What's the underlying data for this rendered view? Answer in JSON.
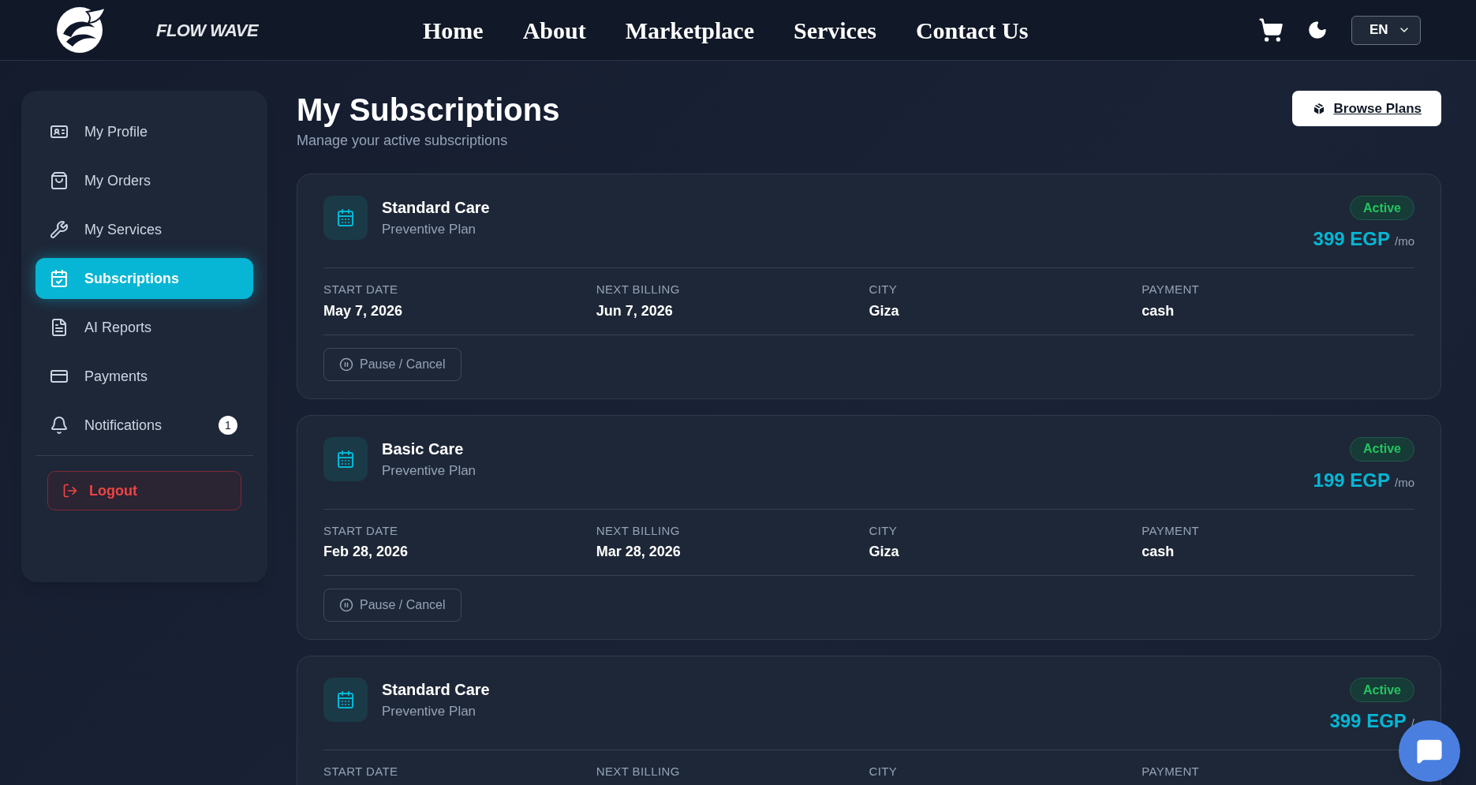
{
  "header": {
    "logo_text": "FLOW WAVE",
    "nav": [
      {
        "label": "Home"
      },
      {
        "label": "About"
      },
      {
        "label": "Marketplace"
      },
      {
        "label": "Services"
      },
      {
        "label": "Contact Us"
      }
    ],
    "language": "EN"
  },
  "sidebar": {
    "items": [
      {
        "label": "My Profile",
        "selected": false
      },
      {
        "label": "My Orders",
        "selected": false
      },
      {
        "label": "My Services",
        "selected": false
      },
      {
        "label": "Subscriptions",
        "selected": true
      },
      {
        "label": "AI Reports",
        "selected": false
      },
      {
        "label": "Payments",
        "selected": false
      },
      {
        "label": "Notifications",
        "selected": false,
        "badge": "1"
      }
    ],
    "logout": "Logout"
  },
  "page": {
    "title": "My Subscriptions",
    "subtitle": "Manage your active subscriptions",
    "browse_button": "Browse Plans"
  },
  "subscriptions": [
    {
      "name": "Standard Care",
      "plan": "Preventive Plan",
      "status": "Active",
      "price": "399 EGP",
      "period": "/mo",
      "details": [
        {
          "label": "START DATE",
          "value": "May 7, 2026"
        },
        {
          "label": "NEXT BILLING",
          "value": "Jun 7, 2026"
        },
        {
          "label": "CITY",
          "value": "Giza"
        },
        {
          "label": "PAYMENT",
          "value": "cash"
        }
      ],
      "action": "Pause / Cancel"
    },
    {
      "name": "Basic Care",
      "plan": "Preventive Plan",
      "status": "Active",
      "price": "199 EGP",
      "period": "/mo",
      "details": [
        {
          "label": "START DATE",
          "value": "Feb 28, 2026"
        },
        {
          "label": "NEXT BILLING",
          "value": "Mar 28, 2026"
        },
        {
          "label": "CITY",
          "value": "Giza"
        },
        {
          "label": "PAYMENT",
          "value": "cash"
        }
      ],
      "action": "Pause / Cancel"
    },
    {
      "name": "Standard Care",
      "plan": "Preventive Plan",
      "status": "Active",
      "price": "399 EGP",
      "period": "/",
      "details": [
        {
          "label": "START DATE"
        },
        {
          "label": "NEXT BILLING"
        },
        {
          "label": "CITY"
        },
        {
          "label": "PAYMENT"
        }
      ]
    }
  ]
}
